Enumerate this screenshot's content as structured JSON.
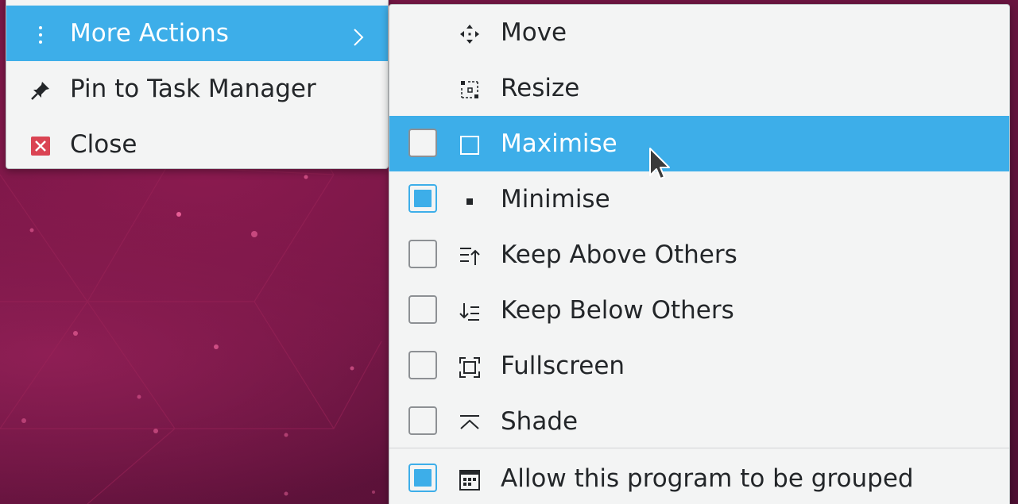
{
  "main_menu": {
    "items": [
      {
        "label": "More Actions",
        "icon": "more-vertical-icon",
        "highlighted": true,
        "has_submenu": true
      },
      {
        "label": "Pin to Task Manager",
        "icon": "pin-icon",
        "highlighted": false
      },
      {
        "label": "Close",
        "icon": "close-window-icon",
        "highlighted": false
      }
    ]
  },
  "more_actions_menu": {
    "items": [
      {
        "label": "Move",
        "icon": "move-icon",
        "has_checkbox": false
      },
      {
        "label": "Resize",
        "icon": "resize-icon",
        "has_checkbox": false
      },
      {
        "label": "Maximise",
        "icon": "maximise-icon",
        "has_checkbox": true,
        "checked": false,
        "highlighted": true
      },
      {
        "label": "Minimise",
        "icon": "minimise-icon",
        "has_checkbox": true,
        "checked": true
      },
      {
        "label": "Keep Above Others",
        "icon": "keep-above-icon",
        "has_checkbox": true,
        "checked": false
      },
      {
        "label": "Keep Below Others",
        "icon": "keep-below-icon",
        "has_checkbox": true,
        "checked": false
      },
      {
        "label": "Fullscreen",
        "icon": "fullscreen-icon",
        "has_checkbox": true,
        "checked": false
      },
      {
        "label": "Shade",
        "icon": "shade-icon",
        "has_checkbox": true,
        "checked": false
      },
      {
        "label": "Allow this program to be grouped",
        "icon": "grouping-icon",
        "has_checkbox": true,
        "checked": true
      }
    ]
  },
  "colors": {
    "highlight": "#3daee9",
    "menu_background": "#f3f4f4",
    "text": "#232629",
    "close_icon": "#da4453"
  }
}
